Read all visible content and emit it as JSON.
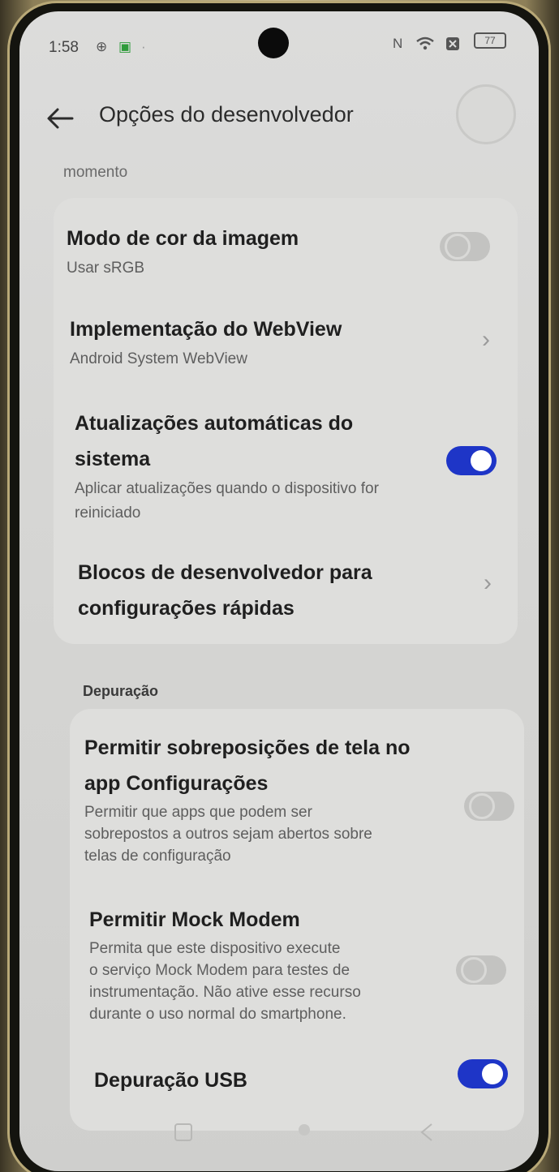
{
  "status_bar": {
    "time": "1:58",
    "battery": "77"
  },
  "header": {
    "title": "Opções do desenvolvedor",
    "back_icon": "arrow-left-icon"
  },
  "scroll_hint": "momento",
  "card1": {
    "items": [
      {
        "title": "Modo de cor da imagem",
        "subtitle": "Usar sRGB",
        "control": "toggle",
        "state": "off"
      },
      {
        "title": "Implementação do WebView",
        "subtitle": "Android System WebView",
        "control": "chevron"
      },
      {
        "title_lines": [
          "Atualizações automáticas do",
          "sistema"
        ],
        "subtitle_lines": [
          "Aplicar atualizações quando o dispositivo for",
          "reiniciado"
        ],
        "control": "toggle",
        "state": "on"
      },
      {
        "title_lines": [
          "Blocos de desenvolvedor para",
          "configurações rápidas"
        ],
        "control": "chevron"
      }
    ]
  },
  "section2": {
    "header": "Depuração",
    "items": [
      {
        "title_lines": [
          "Permitir sobreposições de tela no",
          "app Configurações"
        ],
        "subtitle_lines": [
          "Permitir que apps que podem ser",
          "sobrepostos a outros sejam abertos sobre",
          "telas de configuração"
        ],
        "control": "toggle",
        "state": "off"
      },
      {
        "title": "Permitir Mock Modem",
        "subtitle_lines": [
          "Permita que este dispositivo execute",
          "o serviço Mock Modem para testes de",
          "instrumentação. Não ative esse recurso",
          "durante o uso normal do smartphone."
        ],
        "control": "toggle",
        "state": "off"
      },
      {
        "title": "Depuração USB",
        "control": "toggle",
        "state": "on"
      }
    ]
  },
  "nav": {
    "recent_icon": "recent-apps-icon",
    "home_icon": "home-dot-icon",
    "back_icon": "back-gesture-icon"
  }
}
